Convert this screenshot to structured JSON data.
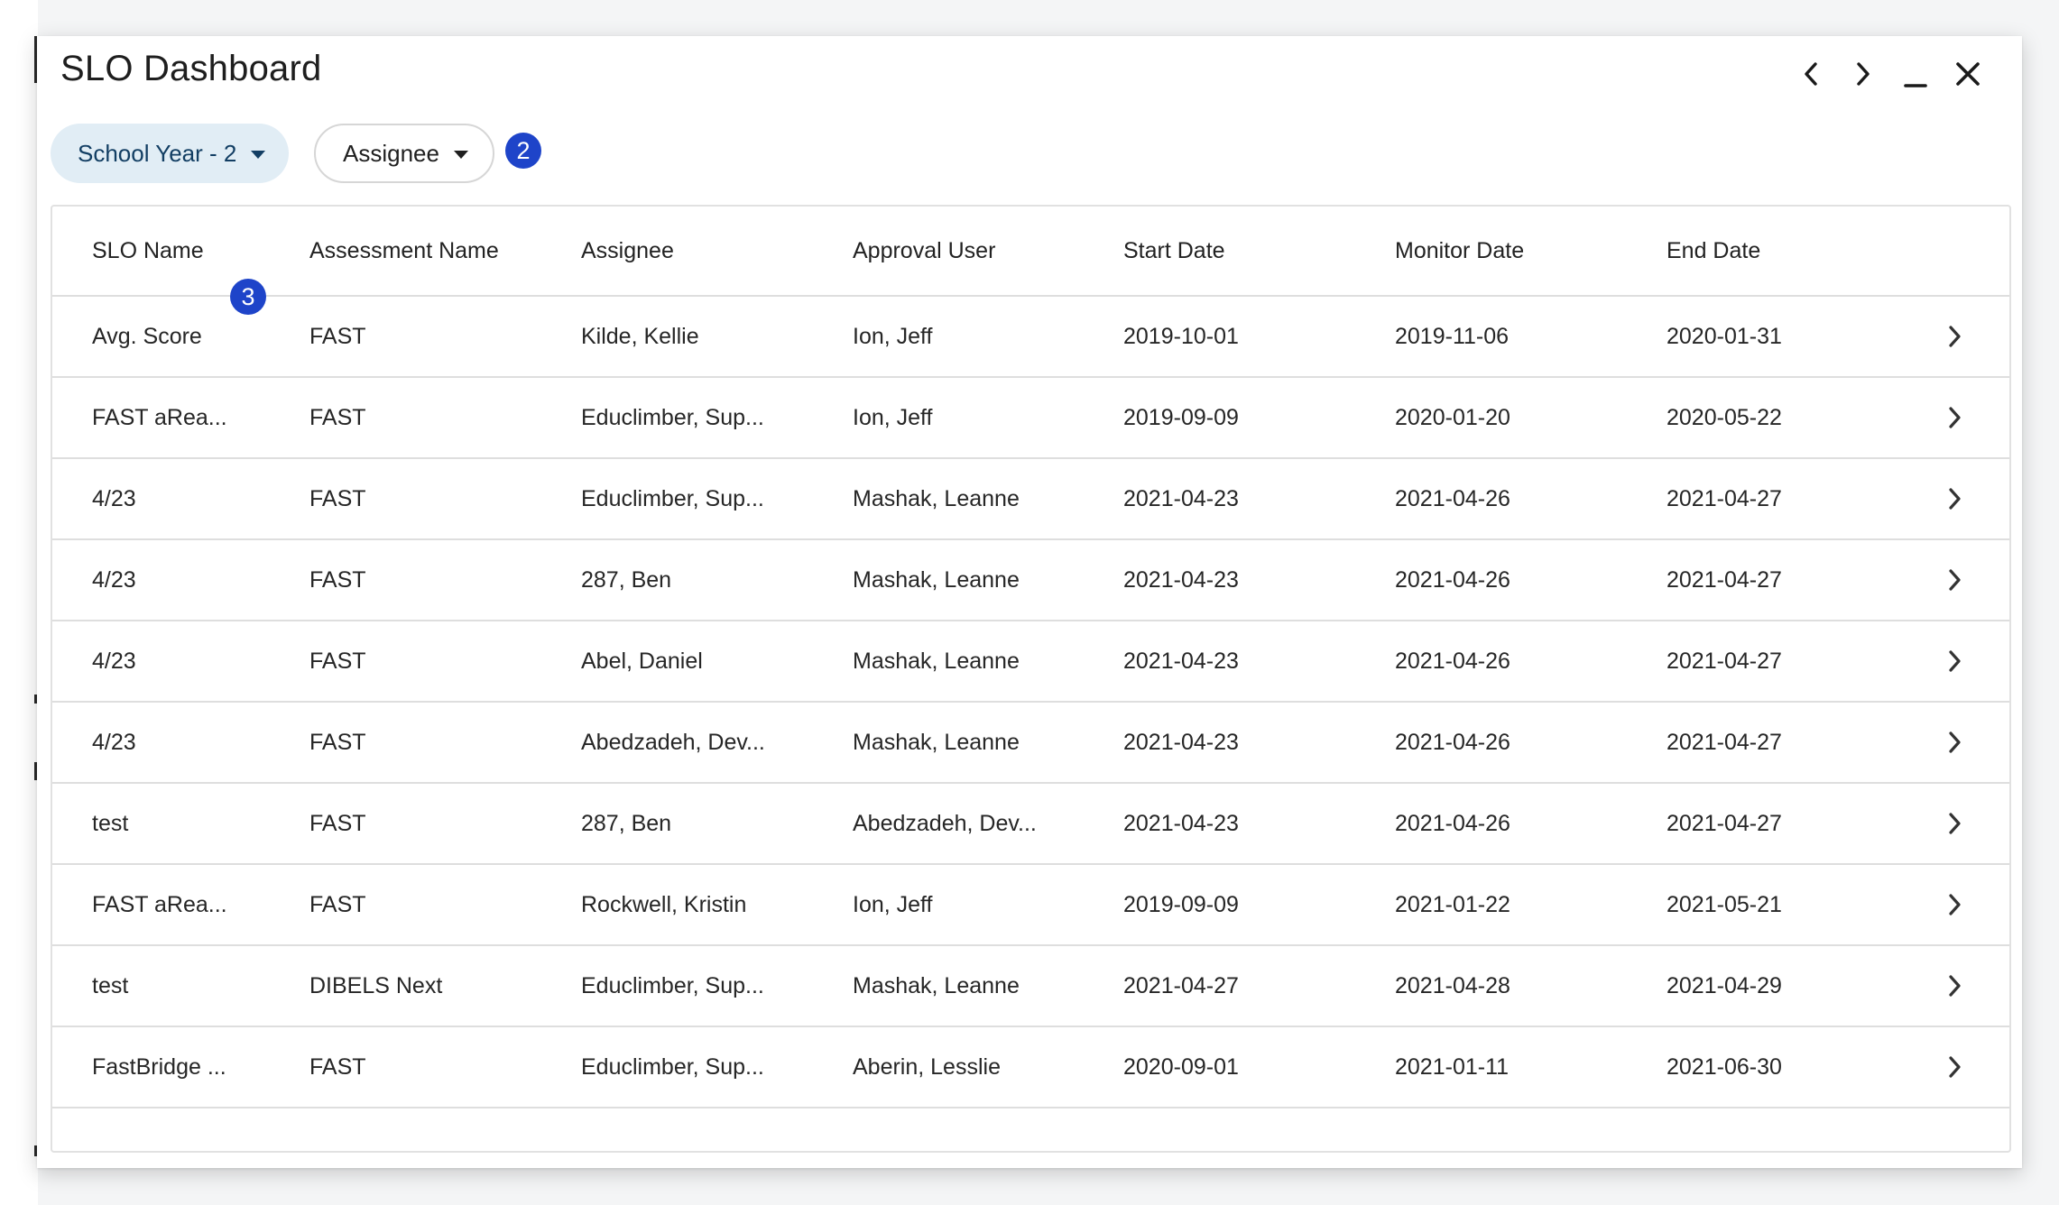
{
  "window": {
    "title": "SLO Dashboard",
    "controls": [
      "chevron-left-icon",
      "chevron-right-icon",
      "minimize-icon",
      "close-icon"
    ]
  },
  "filters": {
    "school_year": "School Year - 2",
    "assignee": "Assignee",
    "assignee_badge": "2"
  },
  "annotation_badge_3": "3",
  "table": {
    "headers": [
      "SLO Name",
      "Assessment Name",
      "Assignee",
      "Approval User",
      "Start Date",
      "Monitor Date",
      "End Date"
    ],
    "rows": [
      [
        "Avg. Score",
        "FAST",
        "Kilde, Kellie",
        "Ion, Jeff",
        "2019-10-01",
        "2019-11-06",
        "2020-01-31"
      ],
      [
        "FAST aRea...",
        "FAST",
        "Educlimber, Sup...",
        "Ion, Jeff",
        "2019-09-09",
        "2020-01-20",
        "2020-05-22"
      ],
      [
        "4/23",
        "FAST",
        "Educlimber, Sup...",
        "Mashak, Leanne",
        "2021-04-23",
        "2021-04-26",
        "2021-04-27"
      ],
      [
        "4/23",
        "FAST",
        "287, Ben",
        "Mashak, Leanne",
        "2021-04-23",
        "2021-04-26",
        "2021-04-27"
      ],
      [
        "4/23",
        "FAST",
        "Abel, Daniel",
        "Mashak, Leanne",
        "2021-04-23",
        "2021-04-26",
        "2021-04-27"
      ],
      [
        "4/23",
        "FAST",
        "Abedzadeh, Dev...",
        "Mashak, Leanne",
        "2021-04-23",
        "2021-04-26",
        "2021-04-27"
      ],
      [
        "test",
        "FAST",
        "287, Ben",
        "Abedzadeh, Dev...",
        "2021-04-23",
        "2021-04-26",
        "2021-04-27"
      ],
      [
        "FAST aRea...",
        "FAST",
        "Rockwell, Kristin",
        "Ion, Jeff",
        "2019-09-09",
        "2021-01-22",
        "2021-05-21"
      ],
      [
        "test",
        "DIBELS Next",
        "Educlimber, Sup...",
        "Mashak, Leanne",
        "2021-04-27",
        "2021-04-28",
        "2021-04-29"
      ],
      [
        "FastBridge ...",
        "FAST",
        "Educlimber, Sup...",
        "Aberin, Lesslie",
        "2020-09-01",
        "2021-01-11",
        "2021-06-30"
      ]
    ]
  },
  "colors": {
    "badge": "#1e44c9",
    "active_pill_bg": "#e1edf5",
    "active_pill_text": "#123e63"
  }
}
